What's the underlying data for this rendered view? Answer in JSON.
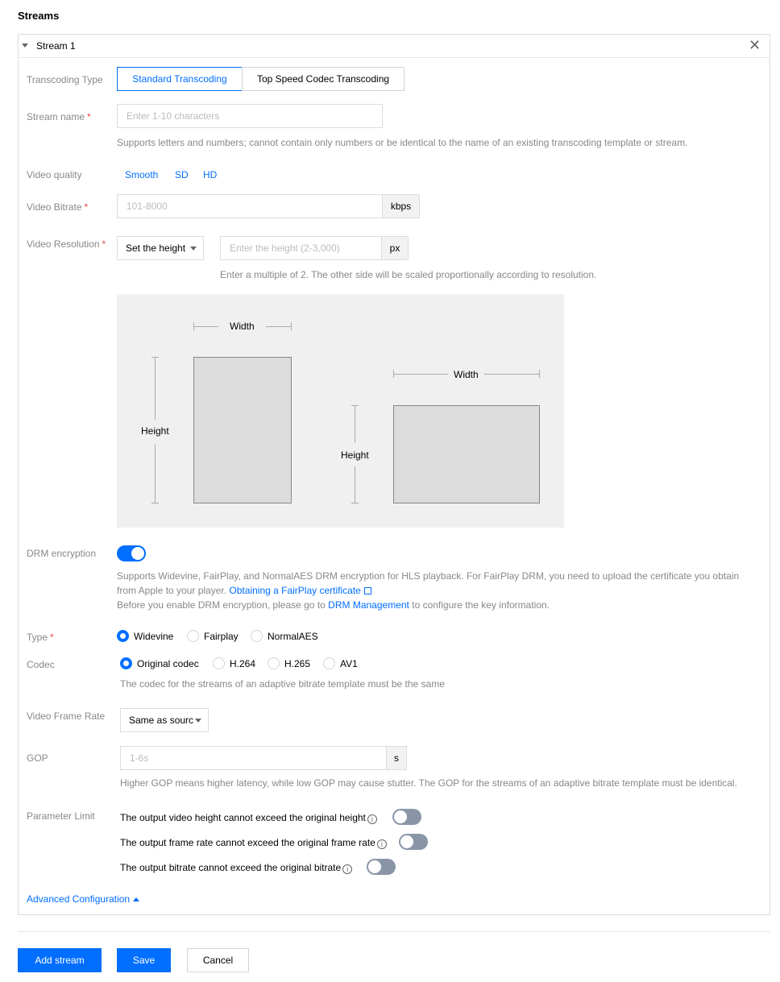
{
  "page": {
    "title": "Streams"
  },
  "stream": {
    "label": "Stream 1"
  },
  "transcoding": {
    "label": "Transcoding Type",
    "options": [
      "Standard Transcoding",
      "Top Speed Codec Transcoding"
    ],
    "selected": "Standard Transcoding"
  },
  "stream_name": {
    "label": "Stream name",
    "placeholder": "Enter 1-10 characters",
    "hint": "Supports letters and numbers; cannot contain only numbers or be identical to the name of an existing transcoding template or stream."
  },
  "video_quality": {
    "label": "Video quality",
    "options": [
      "Smooth",
      "SD",
      "HD"
    ]
  },
  "video_bitrate": {
    "label": "Video Bitrate",
    "placeholder": "101-8000",
    "unit": "kbps"
  },
  "video_resolution": {
    "label": "Video Resolution",
    "select_value": "Set the height",
    "placeholder": "Enter the height (2-3,000)",
    "unit": "px",
    "hint": "Enter a multiple of 2. The other side will be scaled proportionally according to resolution."
  },
  "diagram": {
    "width_label": "Width",
    "height_label": "Height"
  },
  "drm": {
    "label": "DRM encryption",
    "enabled": true,
    "hint_line1": "Supports Widevine, FairPlay, and NormalAES DRM encryption for HLS playback. For FairPlay DRM, you need to upload the certificate you obtain",
    "hint_line2_prefix": "from Apple to your player.",
    "fairplay_link": "Obtaining a FairPlay certificate",
    "hint_line3_prefix": "Before you enable DRM encryption, please go to",
    "drm_link": "DRM Management",
    "hint_line3_suffix": "to configure the key information."
  },
  "type": {
    "label": "Type",
    "options": [
      "Widevine",
      "Fairplay",
      "NormalAES"
    ],
    "selected": "Widevine"
  },
  "codec": {
    "label": "Codec",
    "options": [
      "Original codec",
      "H.264",
      "H.265",
      "AV1"
    ],
    "selected": "Original codec",
    "hint": "The codec for the streams of an adaptive bitrate template must be the same"
  },
  "frame_rate": {
    "label": "Video Frame Rate",
    "value": "Same as sourc"
  },
  "gop": {
    "label": "GOP",
    "placeholder": "1-6s",
    "unit": "s",
    "hint": "Higher GOP means higher latency, while low GOP may cause stutter. The GOP for the streams of an adaptive bitrate template must be identical."
  },
  "param_limit": {
    "label": "Parameter Limit",
    "items": [
      {
        "text": "The output video height cannot exceed the original height",
        "enabled": false
      },
      {
        "text": "The output frame rate cannot exceed the original frame rate",
        "enabled": false
      },
      {
        "text": "The output bitrate cannot exceed the original bitrate",
        "enabled": false
      }
    ]
  },
  "advanced": {
    "label": "Advanced Configuration"
  },
  "actions": {
    "add_stream": "Add stream",
    "save": "Save",
    "cancel": "Cancel"
  },
  "colors": {
    "accent": "#006eff",
    "required": "#e54545",
    "toggle_off": "#8a96a8"
  }
}
